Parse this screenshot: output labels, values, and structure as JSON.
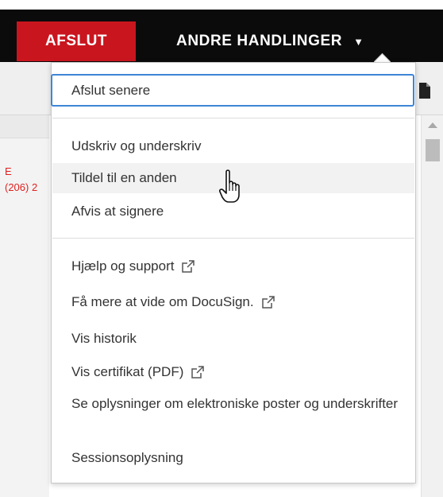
{
  "topbar": {
    "finish_label": "AFSLUT",
    "other_actions_label": "ANDRE HANDLINGER",
    "other_actions_caret": "▼"
  },
  "document": {
    "snippet_line1": "E",
    "snippet_line2": "(206) 2"
  },
  "menu": {
    "items": [
      {
        "label": "Afslut senere"
      },
      {
        "label": "Udskriv og underskriv"
      },
      {
        "label": "Tildel til en anden"
      },
      {
        "label": "Afvis at signere"
      },
      {
        "label": "Hjælp og support",
        "external": true
      },
      {
        "label": "Få mere at vide om DocuSign.",
        "external": true
      },
      {
        "label": "Vis historik"
      },
      {
        "label": "Vis certifikat (PDF)",
        "external": true
      },
      {
        "label": "Se oplysninger om elektroniske poster og underskrifter"
      },
      {
        "label": "Sessionsoplysning"
      }
    ]
  },
  "colors": {
    "brand_red": "#c9151e",
    "focus_blue": "#3e86d6",
    "topbar_black": "#0b0b0b"
  },
  "icons": {
    "external": "external-link-icon",
    "cursor": "hand-pointer-icon",
    "caret": "caret-down-icon"
  }
}
